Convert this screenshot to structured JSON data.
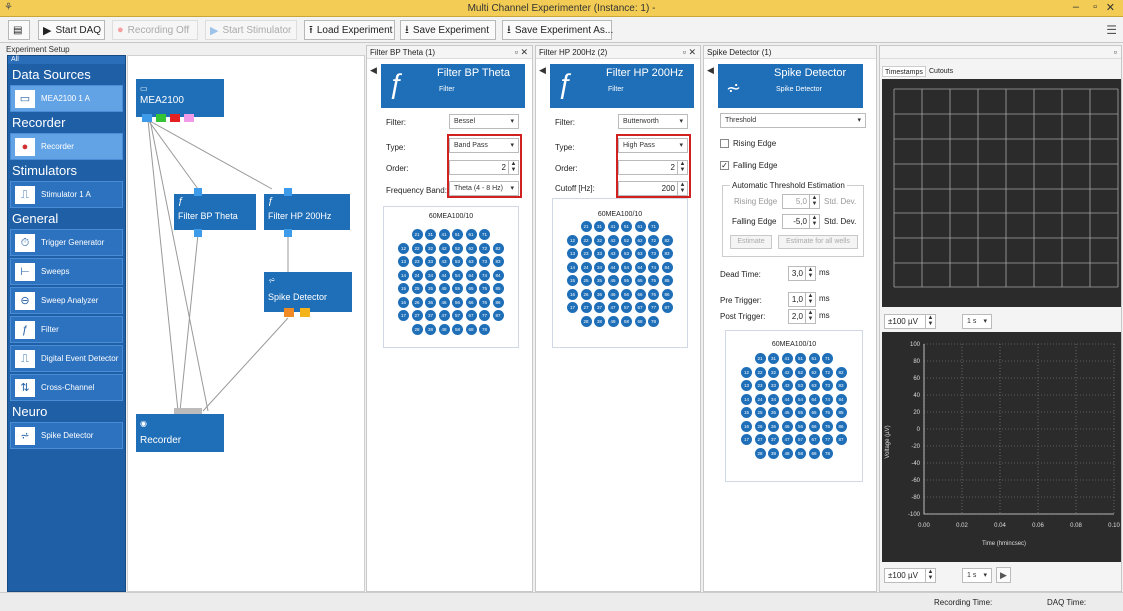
{
  "window": {
    "title": "Multi Channel Experimenter (Instance: 1) -"
  },
  "toolbar": {
    "start_daq": "Start DAQ",
    "recording_off": "Recording Off",
    "start_stimulator": "Start Stimulator",
    "load_experiment": "Load Experiment",
    "save_experiment": "Save Experiment",
    "save_experiment_as": "Save Experiment As..."
  },
  "setup": {
    "title": "Experiment Setup",
    "filter_all": "All",
    "categories": {
      "data_sources": "Data Sources",
      "recorder": "Recorder",
      "stimulators": "Stimulators",
      "general": "General",
      "neuro": "Neuro"
    },
    "items": {
      "mea2100": "MEA2100   1   A",
      "recorder": "Recorder",
      "stimulator": "Stimulator   1   A",
      "trigger_generator": "Trigger Generator",
      "sweeps": "Sweeps",
      "sweep_analyzer": "Sweep Analyzer",
      "filter": "Filter",
      "digital_event_detector": "Digital Event Detector",
      "cross_channel": "Cross-Channel",
      "spike_detector": "Spike Detector"
    }
  },
  "canvas": {
    "nodes": {
      "mea2100": "MEA2100",
      "filter_bp": "Filter BP Theta",
      "filter_hp": "Filter HP 200Hz",
      "spike_detector": "Spike Detector",
      "recorder": "Recorder"
    }
  },
  "panel_bp": {
    "title": "Filter BP Theta (1)",
    "head_title": "Filter BP Theta",
    "head_sub": "Filter",
    "filter_label": "Filter:",
    "filter_value": "Bessel",
    "type_label": "Type:",
    "type_value": "Band Pass",
    "order_label": "Order:",
    "order_value": "2",
    "band_label": "Frequency Band:",
    "band_value": "Theta (4 - 8 Hz)",
    "mea_title": "60MEA100/10"
  },
  "panel_hp": {
    "title": "Filter HP 200Hz (2)",
    "head_title": "Filter HP 200Hz",
    "head_sub": "Filter",
    "filter_label": "Filter:",
    "filter_value": "Butterworth",
    "type_label": "Type:",
    "type_value": "High Pass",
    "order_label": "Order:",
    "order_value": "2",
    "cutoff_label": "Cutoff [Hz]:",
    "cutoff_value": "200",
    "mea_title": "60MEA100/10"
  },
  "panel_spike": {
    "title": "Spike Detector (1)",
    "head_title": "Spike Detector",
    "head_sub": "Spike Detector",
    "method_value": "Threshold",
    "rising_edge": "Rising Edge",
    "falling_edge": "Falling Edge",
    "auto_title": "Automatic Threshold Estimation",
    "rising_label": "Rising Edge",
    "rising_value": "5,0",
    "falling_label": "Falling Edge",
    "falling_value": "-5,0",
    "std_dev": "Std. Dev.",
    "estimate": "Estimate",
    "estimate_all": "Estimate for all wells",
    "dead_time_label": "Dead Time:",
    "dead_time_value": "3,0",
    "pre_trigger_label": "Pre Trigger:",
    "pre_trigger_value": "1,0",
    "post_trigger_label": "Post Trigger:",
    "post_trigger_value": "2,0",
    "unit_ms": "ms",
    "mea_title": "60MEA100/10"
  },
  "viewer": {
    "tab_timestamps": "Timestamps",
    "tab_cutouts": "Cutouts",
    "scale_value": "±100 µV",
    "time_value": "1 s",
    "y_axis_label": "Voltage (µV)",
    "x_axis_label": "Time (hmincsec)",
    "y_ticks": [
      "100",
      "80",
      "60",
      "40",
      "20",
      "0",
      "-20",
      "-40",
      "-60",
      "-80",
      "-100"
    ],
    "x_ticks": [
      "0.00",
      "0.02",
      "0.04",
      "0.06",
      "0.08",
      "0.10"
    ]
  },
  "electrodes": [
    [
      "",
      "21",
      "31",
      "41",
      "51",
      "61",
      "71",
      ""
    ],
    [
      "12",
      "22",
      "32",
      "42",
      "52",
      "62",
      "72",
      "82"
    ],
    [
      "13",
      "23",
      "33",
      "43",
      "53",
      "63",
      "73",
      "83"
    ],
    [
      "14",
      "24",
      "34",
      "44",
      "54",
      "64",
      "74",
      "84"
    ],
    [
      "15",
      "25",
      "35",
      "45",
      "55",
      "65",
      "75",
      "85"
    ],
    [
      "16",
      "26",
      "36",
      "46",
      "56",
      "66",
      "76",
      "86"
    ],
    [
      "17",
      "27",
      "37",
      "47",
      "57",
      "67",
      "77",
      "87"
    ],
    [
      "",
      "28",
      "38",
      "48",
      "58",
      "68",
      "78",
      ""
    ]
  ],
  "status": {
    "recording_time": "Recording Time:",
    "daq_time": "DAQ Time:"
  }
}
